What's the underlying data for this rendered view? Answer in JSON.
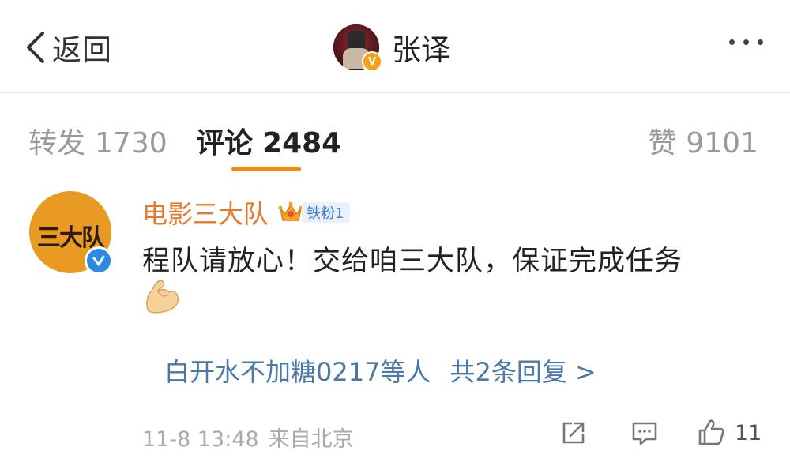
{
  "header": {
    "back_label": "返回",
    "username": "张译",
    "verified_badge": "V",
    "colors": {
      "verified_orange": "#f5a21b"
    },
    "icons": [
      "chevron-left-icon",
      "more-dots-icon"
    ]
  },
  "tabs": {
    "repost": {
      "label": "转发",
      "count": "1730"
    },
    "comment": {
      "label": "评论",
      "count": "2484",
      "active": true
    },
    "like": {
      "label": "赞",
      "count": "9101"
    },
    "indicator_color": "#f08a1c"
  },
  "comment": {
    "avatar_text": "三大队",
    "author": "电影三大队",
    "fan_badge": "铁粉1",
    "text": "程队请放心！交给咱三大队，保证完成任务",
    "emoji": "flexed-biceps",
    "replies": {
      "names": "白开水不加糖0217等人",
      "count_text": "共2条回复 >"
    },
    "timestamp": "11-8 13:48",
    "source": "来自北京",
    "like_count": "11",
    "colors": {
      "author": "#e8782a",
      "replies_link": "#4a78a8",
      "verified_blue": "#2d8ae0"
    }
  }
}
